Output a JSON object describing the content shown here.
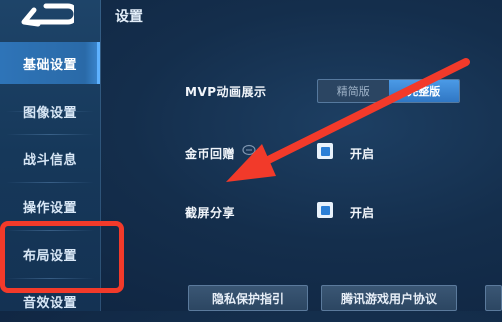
{
  "header": {
    "title": "设置"
  },
  "sidebar": {
    "items": [
      {
        "label": "基础设置",
        "active": true
      },
      {
        "label": "图像设置",
        "active": false
      },
      {
        "label": "战斗信息",
        "active": false
      },
      {
        "label": "操作设置",
        "active": false
      },
      {
        "label": "布局设置",
        "active": false
      },
      {
        "label": "音效设置",
        "active": false
      }
    ]
  },
  "settings": {
    "mvp": {
      "label": "MVP动画展示",
      "options": [
        "精简版",
        "完整版"
      ],
      "selected": "完整版"
    },
    "coin_return": {
      "label": "金币回赠",
      "checked": true,
      "state_label": "开启"
    },
    "screenshot_share": {
      "label": "截屏分享",
      "checked": true,
      "state_label": "开启"
    }
  },
  "footer": {
    "privacy_label": "隐私保护指引",
    "agreement_label": "腾讯游戏用户协议"
  },
  "colors": {
    "accent": "#2e74b8",
    "annotation": "#f23a2a",
    "background": "#142e4c"
  },
  "icons": [
    "back-arrow-icon",
    "coin-icon",
    "check-icon"
  ]
}
